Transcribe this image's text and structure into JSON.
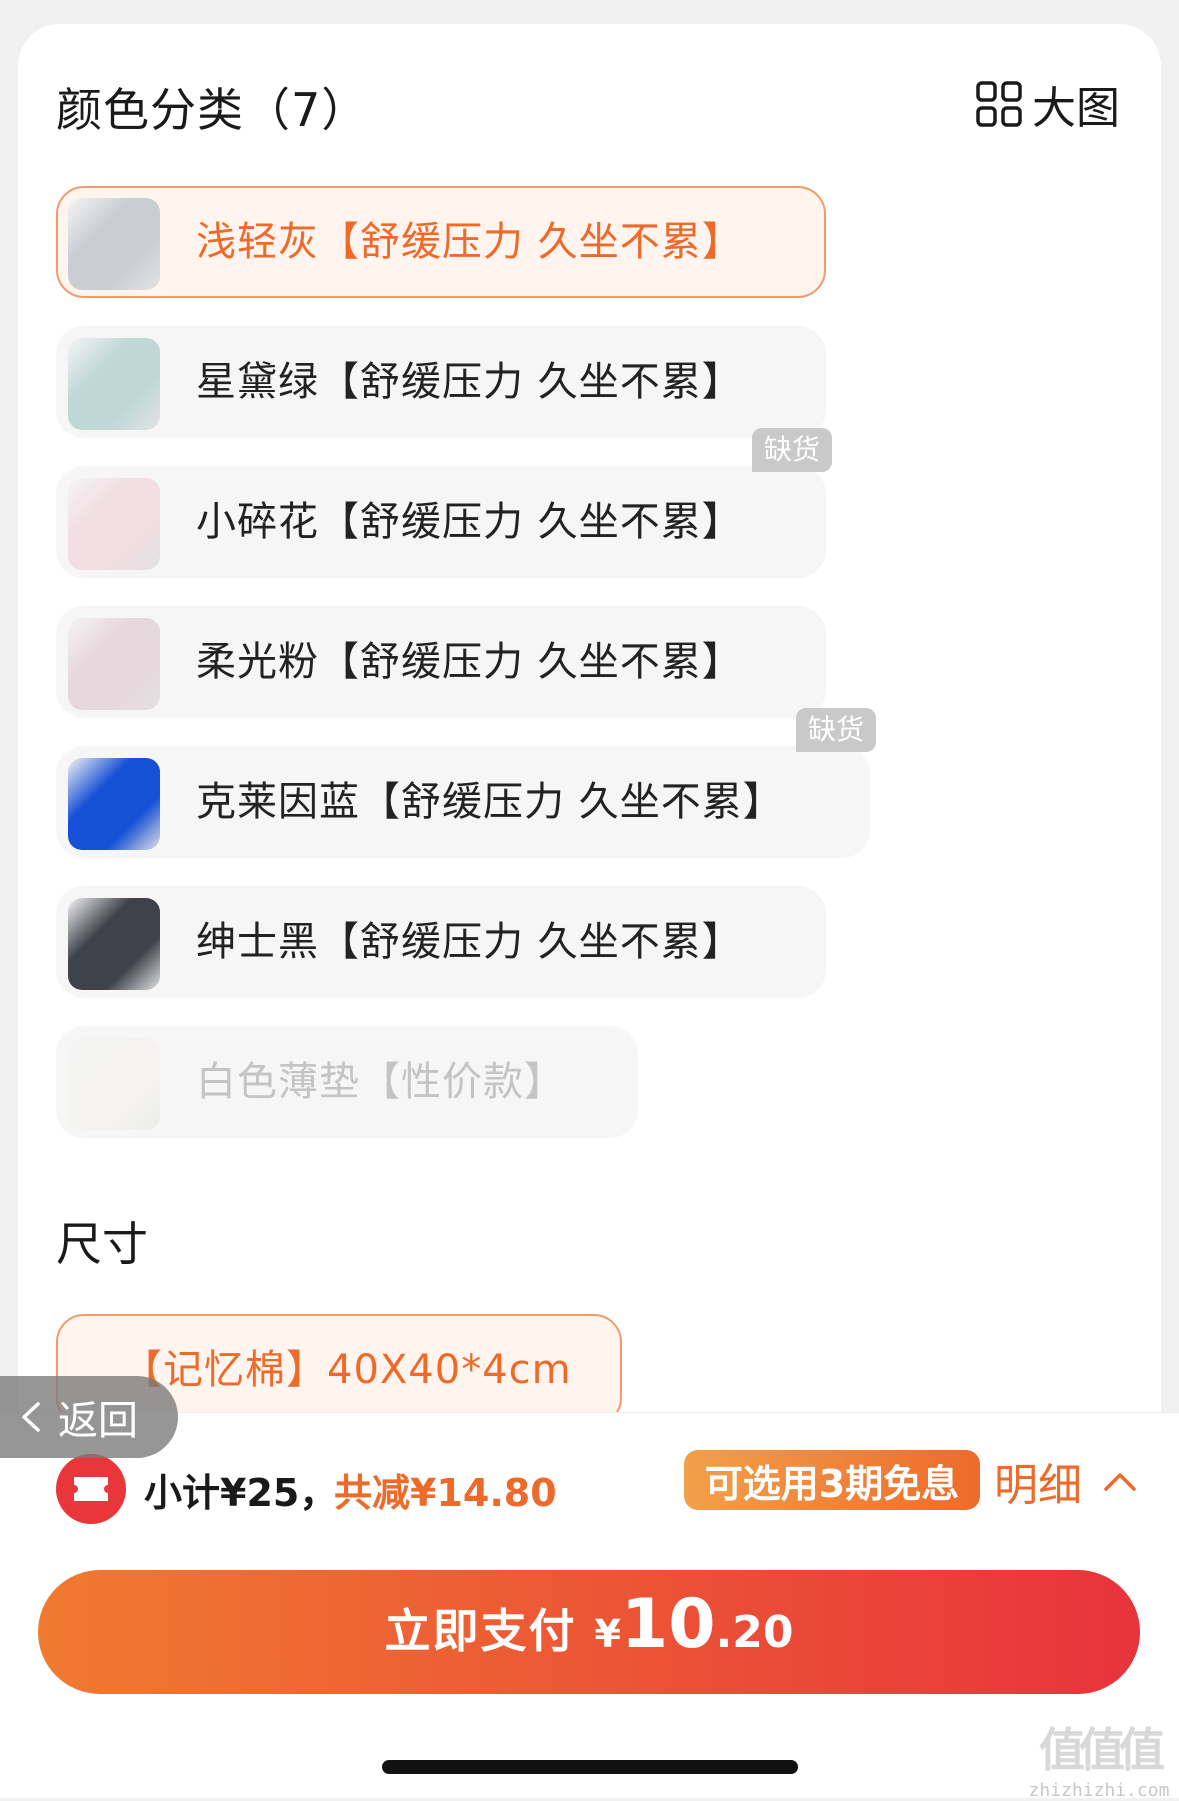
{
  "header": {
    "title": "颜色分类（7）",
    "big_view_label": "大图"
  },
  "color_options": [
    {
      "label": "浅轻灰【舒缓压力 久坐不累】",
      "state": "selected",
      "badge": "",
      "thumb_color": "#c9ced3"
    },
    {
      "label": "星黛绿【舒缓压力 久坐不累】",
      "state": "normal",
      "badge": "",
      "thumb_color": "#bfd8d6"
    },
    {
      "label": "小碎花【舒缓压力 久坐不累】",
      "state": "normal",
      "badge": "缺货",
      "thumb_color": "#f1dde2"
    },
    {
      "label": "柔光粉【舒缓压力 久坐不累】",
      "state": "normal",
      "badge": "",
      "thumb_color": "#e6d7dc"
    },
    {
      "label": "克莱因蓝【舒缓压力 久坐不累】",
      "state": "normal",
      "badge": "缺货",
      "thumb_color": "#1550d6"
    },
    {
      "label": "绅士黑【舒缓压力 久坐不累】",
      "state": "normal",
      "badge": "",
      "thumb_color": "#3e434b"
    },
    {
      "label": "白色薄垫【性价款】",
      "state": "disabled",
      "badge": "",
      "thumb_color": "#f3f1ea"
    }
  ],
  "size_section": {
    "title": "尺寸",
    "selected_label": "【记忆棉】40X40*4cm"
  },
  "back_button": {
    "label": "返回"
  },
  "summary": {
    "subtotal": "小计¥25，",
    "discount": "共减¥14.80",
    "installment_label": "可选用3期免息",
    "detail_label": "明细"
  },
  "pay_button": {
    "label": "立即支付",
    "currency": "¥",
    "amount_int": "10",
    "amount_dec": ".20"
  },
  "watermark": {
    "mark": "值值值",
    "text": "zhizhizhi.com"
  },
  "colors": {
    "accent": "#ee6a2a",
    "pay_gradient_start": "#f07a30",
    "pay_gradient_end": "#e8333b"
  }
}
